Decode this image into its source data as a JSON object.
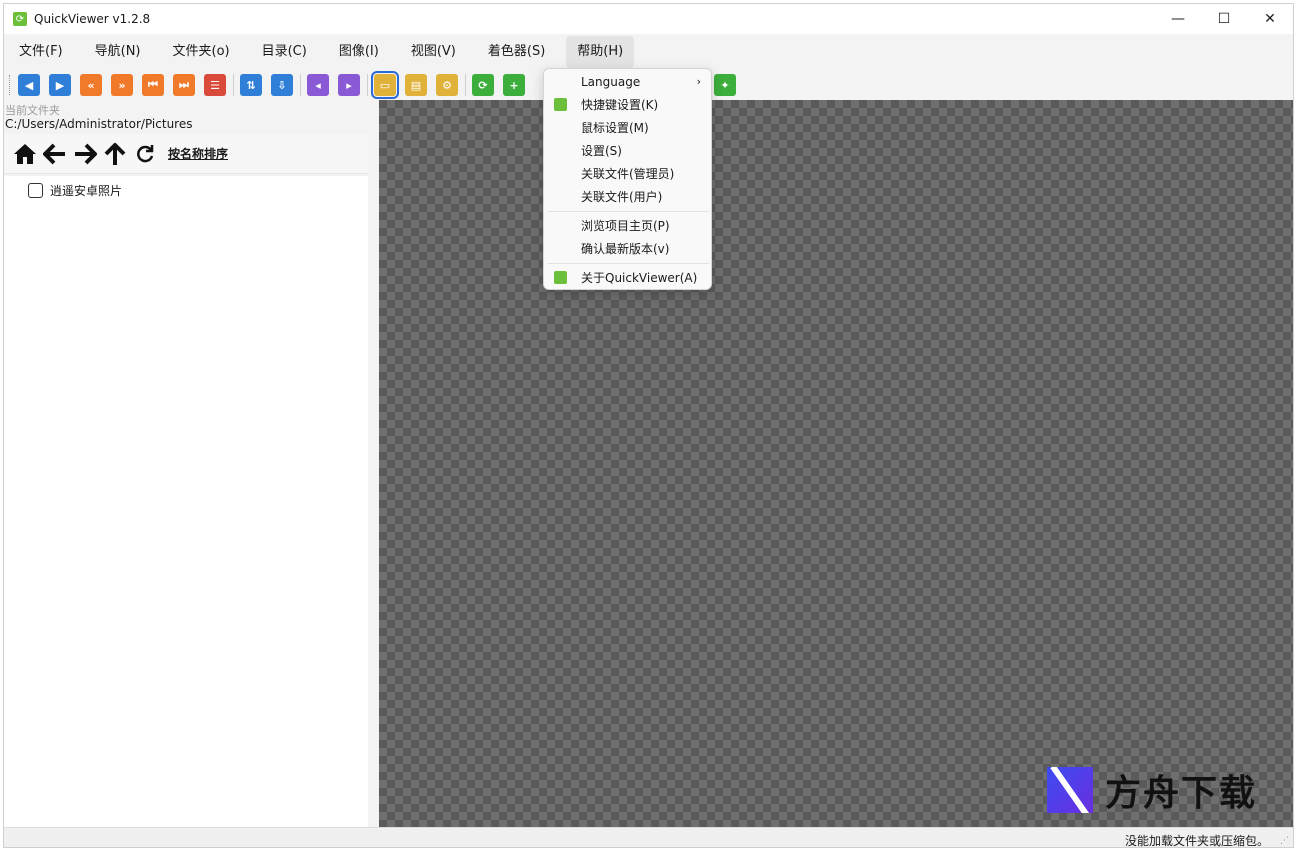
{
  "window": {
    "title": "QuickViewer v1.2.8",
    "controls": {
      "minimize": "—",
      "maximize": "☐",
      "close": "✕"
    }
  },
  "menubar": {
    "items": [
      {
        "label": "文件(F)"
      },
      {
        "label": "导航(N)"
      },
      {
        "label": "文件夹(o)"
      },
      {
        "label": "目录(C)"
      },
      {
        "label": "图像(I)"
      },
      {
        "label": "视图(V)"
      },
      {
        "label": "着色器(S)"
      },
      {
        "label": "帮助(H)"
      }
    ]
  },
  "toolbar": {
    "icons": [
      {
        "name": "prev-image-icon",
        "glyph": "◀",
        "color": "#2f7fd8"
      },
      {
        "name": "next-image-icon",
        "glyph": "▶",
        "color": "#2f7fd8"
      },
      {
        "name": "prev-folder-icon",
        "glyph": "«",
        "color": "#f07a2a"
      },
      {
        "name": "next-folder-icon",
        "glyph": "»",
        "color": "#f07a2a"
      },
      {
        "name": "first-image-icon",
        "glyph": "⏮",
        "color": "#f07a2a"
      },
      {
        "name": "last-image-icon",
        "glyph": "⏭",
        "color": "#f07a2a"
      },
      {
        "name": "catalog-icon",
        "glyph": "☰",
        "color": "#d94a3a"
      },
      {
        "name": "rotate-page-icon",
        "glyph": "⇅",
        "color": "#2f7fd8"
      },
      {
        "name": "save-page-icon",
        "glyph": "⇩",
        "color": "#2f7fd8"
      },
      {
        "name": "prev-page-icon",
        "glyph": "◂",
        "color": "#8a5ad6"
      },
      {
        "name": "next-page-icon",
        "glyph": "▸",
        "color": "#8a5ad6"
      },
      {
        "name": "folder-view-icon",
        "glyph": "▭",
        "color": "#e0b23a"
      },
      {
        "name": "catalog-view-icon",
        "glyph": "▤",
        "color": "#e0b23a"
      },
      {
        "name": "settings-icon",
        "glyph": "⚙",
        "color": "#e0b23a"
      },
      {
        "name": "refresh-icon",
        "glyph": "⟳",
        "color": "#3cae3c"
      },
      {
        "name": "add-icon",
        "glyph": "+",
        "color": "#3cae3c"
      },
      {
        "name": "tag-icon",
        "glyph": "✦",
        "color": "#3cae3c"
      }
    ]
  },
  "left_panel": {
    "folder_label": "当前文件夹",
    "folder_path": "C:/Users/Administrator/Pictures",
    "sort_label": "按名称排序",
    "tree_items": [
      {
        "label": "逍遥安卓照片"
      }
    ]
  },
  "help_menu": {
    "items": [
      {
        "label": "Language",
        "has_submenu": true,
        "icon": false
      },
      {
        "label": "快捷键设置(K)",
        "icon": true
      },
      {
        "label": "鼠标设置(M)",
        "icon": false
      },
      {
        "label": "设置(S)",
        "icon": false
      },
      {
        "label": "关联文件(管理员)",
        "icon": false
      },
      {
        "label": "关联文件(用户)",
        "icon": false
      },
      {
        "label": "浏览项目主页(P)",
        "icon": false
      },
      {
        "label": "确认最新版本(v)",
        "icon": false
      },
      {
        "label": "关于QuickViewer(A)",
        "icon": true
      }
    ],
    "submenu_arrow": "›"
  },
  "statusbar": {
    "text": "没能加载文件夹或压缩包。"
  },
  "watermark": {
    "text": "方舟下载"
  },
  "colors": {
    "accent": "#2a6ad6",
    "app_green": "#6bbf3a"
  }
}
